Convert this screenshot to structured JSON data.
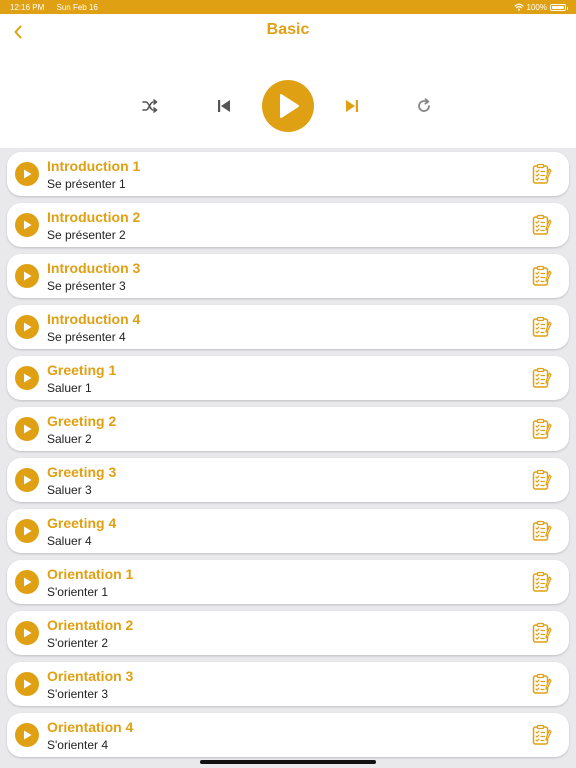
{
  "status_bar": {
    "time": "12:16 PM",
    "date": "Sun Feb 16",
    "battery": "100%",
    "icons": [
      "wifi-icon",
      "battery-icon"
    ]
  },
  "header": {
    "title": "Basic",
    "back_icon": "chevron-left-icon"
  },
  "player_controls": {
    "icons": [
      "shuffle-icon",
      "previous-icon",
      "play-icon",
      "next-icon",
      "repeat-icon"
    ]
  },
  "colors": {
    "accent": "#e0a013",
    "background": "#e9e9ec",
    "card": "#ffffff",
    "text": "#222222"
  },
  "lessons": [
    {
      "title": "Introduction 1",
      "subtitle": "Se présenter 1"
    },
    {
      "title": "Introduction 2",
      "subtitle": "Se présenter 2"
    },
    {
      "title": "Introduction 3",
      "subtitle": "Se présenter 3"
    },
    {
      "title": "Introduction 4",
      "subtitle": "Se présenter 4"
    },
    {
      "title": "Greeting 1",
      "subtitle": "Saluer 1"
    },
    {
      "title": "Greeting 2",
      "subtitle": "Saluer 2"
    },
    {
      "title": "Greeting 3",
      "subtitle": "Saluer 3"
    },
    {
      "title": "Greeting 4",
      "subtitle": "Saluer 4"
    },
    {
      "title": "Orientation 1",
      "subtitle": "S'orienter 1"
    },
    {
      "title": "Orientation 2",
      "subtitle": "S'orienter 2"
    },
    {
      "title": "Orientation 3",
      "subtitle": "S'orienter 3"
    },
    {
      "title": "Orientation 4",
      "subtitle": "S'orienter 4"
    }
  ]
}
